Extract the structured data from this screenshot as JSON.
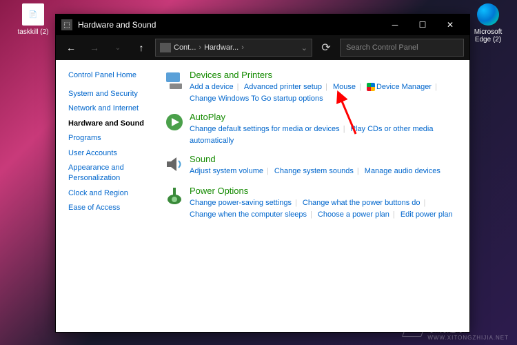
{
  "desktop": {
    "taskkill_label": "taskkill (2)",
    "edge_label": "Microsoft Edge (2)"
  },
  "window": {
    "title": "Hardware and Sound"
  },
  "breadcrumb": {
    "root": "Cont...",
    "current": "Hardwar..."
  },
  "search": {
    "placeholder": "Search Control Panel"
  },
  "sidebar": {
    "home": "Control Panel Home",
    "items": [
      "System and Security",
      "Network and Internet",
      "Hardware and Sound",
      "Programs",
      "User Accounts",
      "Appearance and Personalization",
      "Clock and Region",
      "Ease of Access"
    ]
  },
  "categories": {
    "devprint": {
      "title": "Devices and Printers",
      "links": [
        "Add a device",
        "Advanced printer setup",
        "Mouse",
        "Device Manager",
        "Change Windows To Go startup options"
      ]
    },
    "autoplay": {
      "title": "AutoPlay",
      "links": [
        "Change default settings for media or devices",
        "Play CDs or other media automatically"
      ]
    },
    "sound": {
      "title": "Sound",
      "links": [
        "Adjust system volume",
        "Change system sounds",
        "Manage audio devices"
      ]
    },
    "power": {
      "title": "Power Options",
      "links": [
        "Change power-saving settings",
        "Change what the power buttons do",
        "Change when the computer sleeps",
        "Choose a power plan",
        "Edit power plan"
      ]
    }
  },
  "watermark": {
    "text": "系统之家",
    "url": "WWW.XITONGZHIJIA.NET"
  }
}
